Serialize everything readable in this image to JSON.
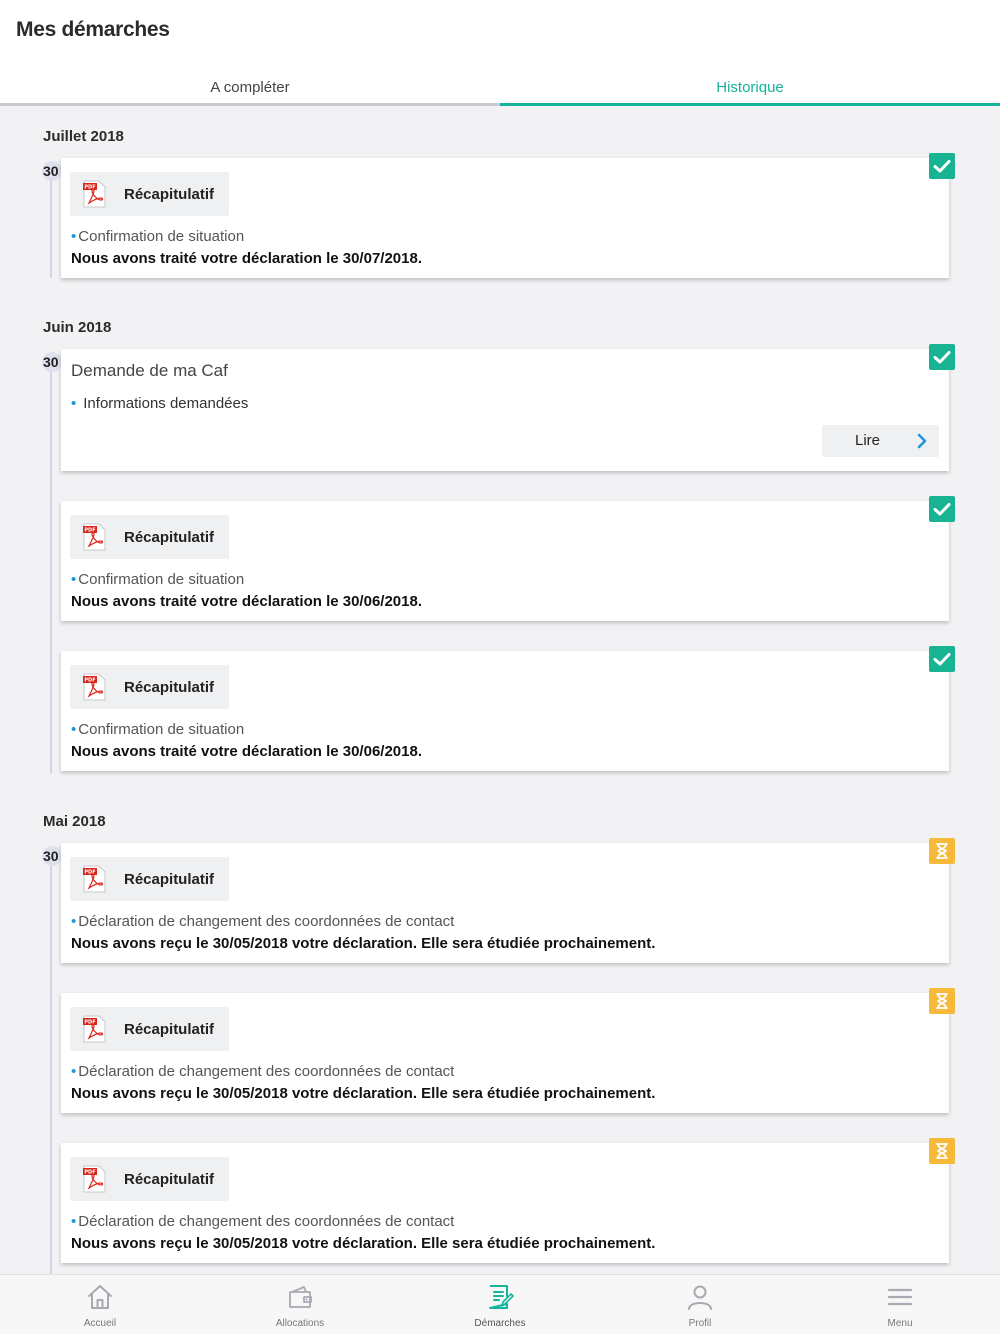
{
  "page_title": "Mes démarches",
  "tabs": [
    {
      "label": "A compléter",
      "active": false
    },
    {
      "label": "Historique",
      "active": true
    }
  ],
  "sections": [
    {
      "month": "Juillet 2018",
      "day": "30",
      "cards": [
        {
          "type": "recap",
          "status": "done",
          "pdf_label": "Récapitulatif",
          "subtitle": "Confirmation de situation",
          "message": "Nous avons traité votre déclaration le 30/07/2018."
        }
      ]
    },
    {
      "month": "Juin 2018",
      "day": "30",
      "cards": [
        {
          "type": "request",
          "status": "done",
          "title": "Demande de ma Caf",
          "item": "Informations demandées",
          "button": "Lire"
        },
        {
          "type": "recap",
          "status": "done",
          "pdf_label": "Récapitulatif",
          "subtitle": "Confirmation de situation",
          "message": "Nous avons traité votre déclaration le 30/06/2018."
        },
        {
          "type": "recap",
          "status": "done",
          "pdf_label": "Récapitulatif",
          "subtitle": "Confirmation de situation",
          "message": "Nous avons traité votre déclaration le 30/06/2018."
        }
      ]
    },
    {
      "month": "Mai 2018",
      "day": "30",
      "cards": [
        {
          "type": "recap",
          "status": "pending",
          "pdf_label": "Récapitulatif",
          "subtitle": "Déclaration de changement des coordonnées de contact",
          "message": "Nous avons reçu le 30/05/2018 votre déclaration. Elle sera étudiée prochainement."
        },
        {
          "type": "recap",
          "status": "pending",
          "pdf_label": "Récapitulatif",
          "subtitle": "Déclaration de changement des coordonnées de contact",
          "message": "Nous avons reçu le 30/05/2018 votre déclaration. Elle sera étudiée prochainement."
        },
        {
          "type": "recap",
          "status": "pending",
          "pdf_label": "Récapitulatif",
          "subtitle": "Déclaration de changement des coordonnées de contact",
          "message": "Nous avons reçu le 30/05/2018 votre déclaration. Elle sera étudiée prochainement."
        }
      ]
    }
  ],
  "bottom_nav": [
    {
      "label": "Accueil",
      "icon": "home-icon"
    },
    {
      "label": "Allocations",
      "icon": "wallet-icon"
    },
    {
      "label": "Démarches",
      "icon": "document-edit-icon",
      "active": true
    },
    {
      "label": "Profil",
      "icon": "user-icon"
    },
    {
      "label": "Menu",
      "icon": "hamburger-menu-icon"
    }
  ],
  "colors": {
    "accent": "#15b39a",
    "done": "#18b393",
    "pending": "#f6b93a",
    "bullet": "#1a98d5",
    "pdf_red": "#d9261c",
    "background": "#f2f2f4"
  }
}
